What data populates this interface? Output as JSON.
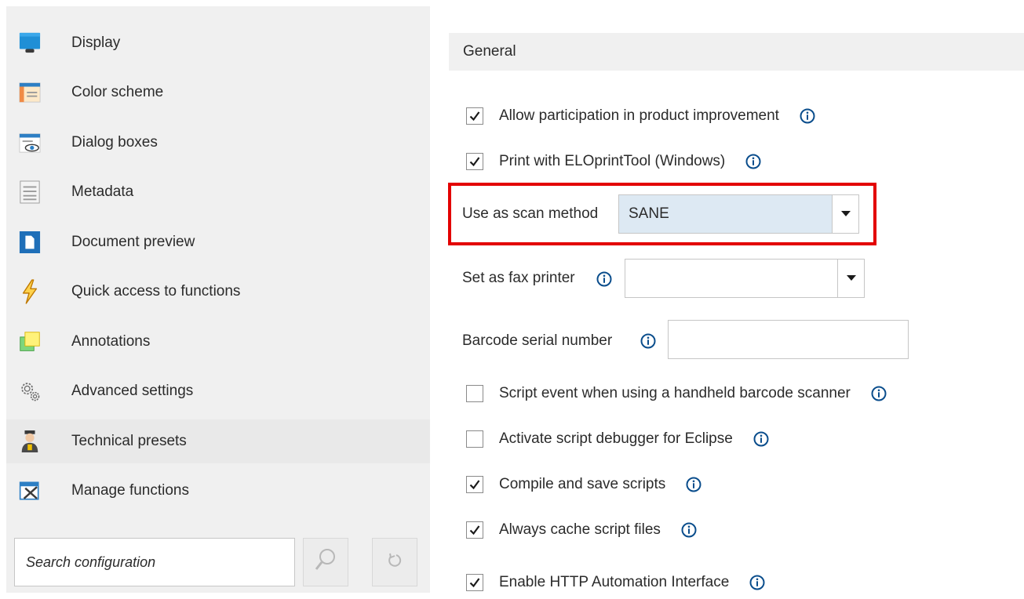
{
  "sidebar": {
    "items": [
      {
        "label": "Display",
        "icon": "monitor-icon"
      },
      {
        "label": "Color scheme",
        "icon": "color-scheme-icon"
      },
      {
        "label": "Dialog boxes",
        "icon": "dialog-boxes-icon"
      },
      {
        "label": "Metadata",
        "icon": "metadata-icon"
      },
      {
        "label": "Document preview",
        "icon": "document-preview-icon"
      },
      {
        "label": "Quick access to functions",
        "icon": "lightning-icon"
      },
      {
        "label": "Annotations",
        "icon": "annotations-icon"
      },
      {
        "label": "Advanced settings",
        "icon": "gears-icon"
      },
      {
        "label": "Technical presets",
        "icon": "technician-icon"
      },
      {
        "label": "Manage functions",
        "icon": "manage-functions-icon"
      }
    ],
    "search": {
      "placeholder": "Search configuration",
      "value": ""
    },
    "search_button_icon": "magnifier-icon",
    "reset_button_icon": "reset-icon"
  },
  "main": {
    "section_title": "General",
    "options": {
      "product_improvement": {
        "label": "Allow participation in product improvement",
        "checked": true
      },
      "print_tool": {
        "label": "Print with ELOprintTool (Windows)",
        "checked": true
      },
      "handheld_scanner": {
        "label": "Script event when using a handheld barcode scanner",
        "checked": false
      },
      "script_debugger": {
        "label": "Activate script debugger for Eclipse",
        "checked": false
      },
      "compile_scripts": {
        "label": "Compile and save scripts",
        "checked": true
      },
      "cache_scripts": {
        "label": "Always cache script files",
        "checked": true
      },
      "http_interface": {
        "label": "Enable HTTP Automation Interface",
        "checked": true
      }
    },
    "scan_method": {
      "label": "Use as scan method",
      "value": "SANE"
    },
    "fax_printer": {
      "label": "Set as fax printer",
      "value": ""
    },
    "barcode_serial": {
      "label": "Barcode serial number",
      "value": ""
    }
  },
  "colors": {
    "accent_blue": "#0a4d8c",
    "highlight_red": "#e30000",
    "selected_field": "#dde9f3",
    "sidebar_bg": "#f0f0f0"
  }
}
